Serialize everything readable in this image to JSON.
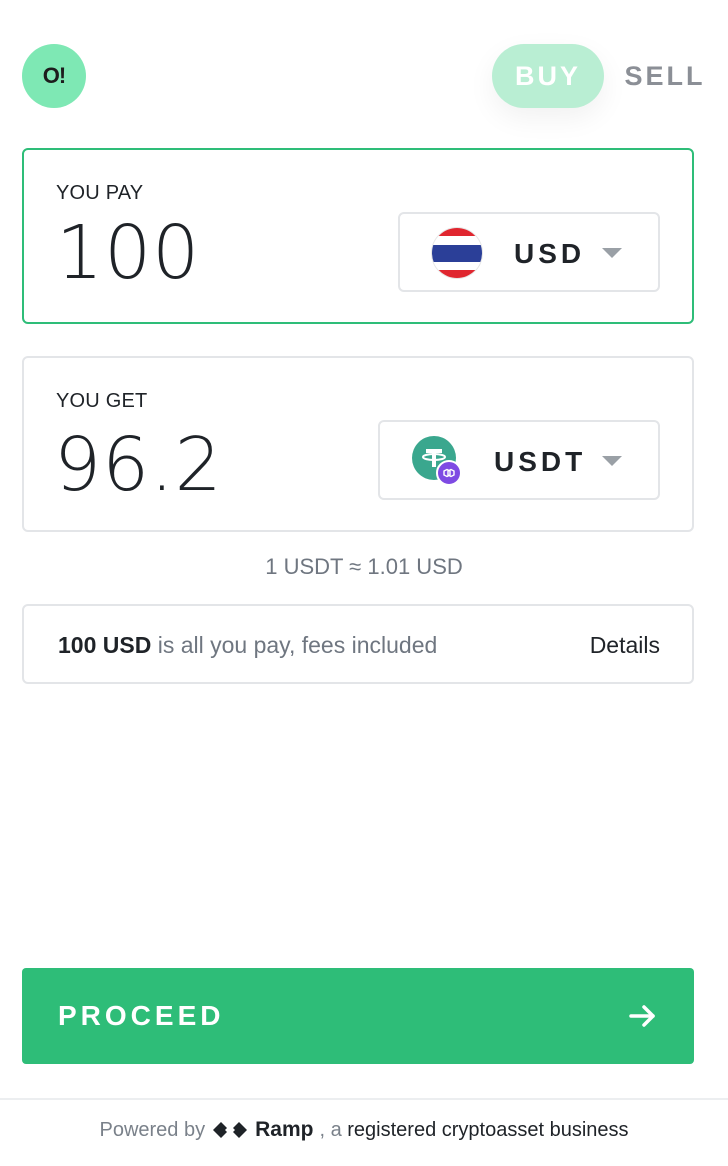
{
  "header": {
    "logo_text": "O!",
    "buy_label": "BUY",
    "sell_label": "SELL",
    "active_tab": "BUY"
  },
  "pay": {
    "label": "YOU PAY",
    "amount": "100",
    "currency": "USD",
    "currency_icon": "thailand-flag-icon"
  },
  "get": {
    "label": "YOU GET",
    "amount": "96.2",
    "currency": "USDT",
    "currency_icon": "usdt-polygon-icon"
  },
  "rate": "1 USDT ≈ 1.01 USD",
  "fees": {
    "amount_bold": "100 USD",
    "text": " is all you pay, fees included",
    "details_label": "Details"
  },
  "proceed": {
    "label": "PROCEED"
  },
  "footer": {
    "powered_by": "Powered by",
    "brand": "Ramp",
    "suffix_a": ", a ",
    "registered": "registered cryptoasset business"
  },
  "colors": {
    "accent": "#2ebd78",
    "logo_bg": "#7ee8b4",
    "buy_bg": "#b9eed3"
  }
}
